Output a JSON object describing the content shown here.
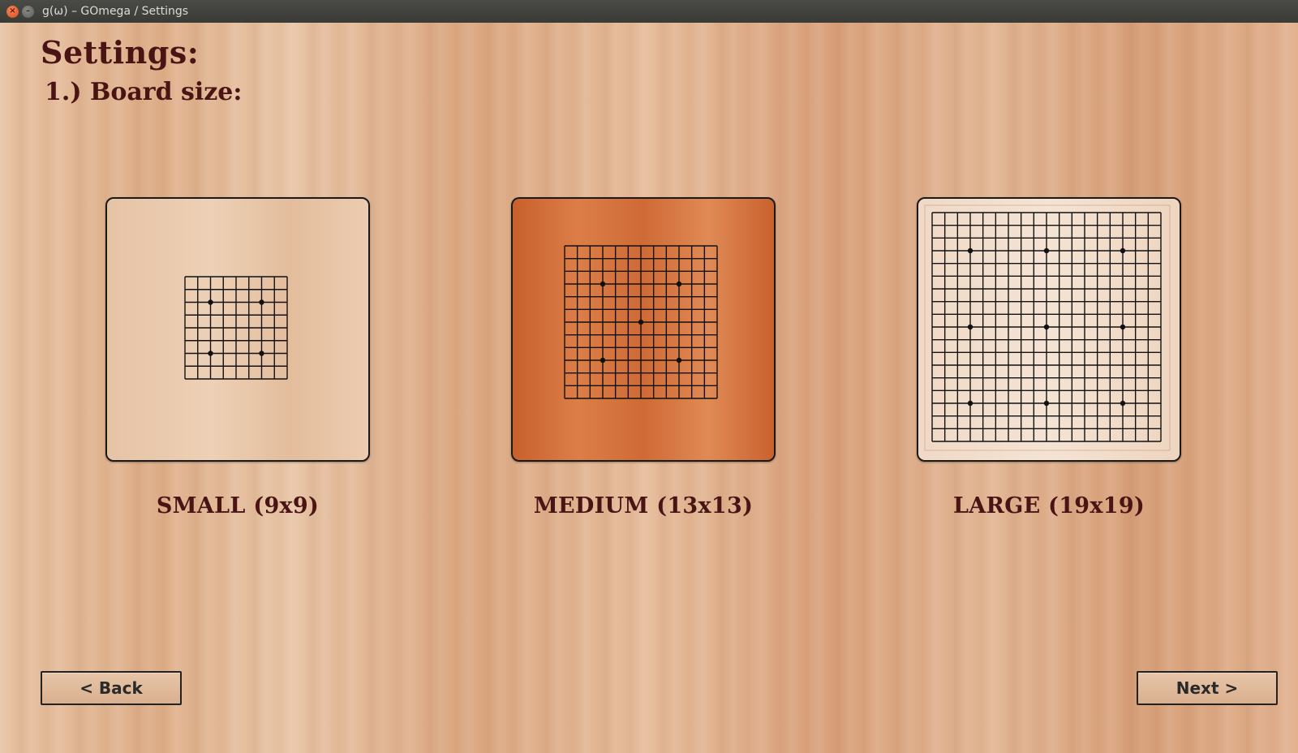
{
  "window": {
    "title": "g(ω) – GOmega / Settings",
    "close_icon": "close-icon",
    "minimize_icon": "minimize-icon"
  },
  "page": {
    "heading": "Settings:",
    "subheading": "1.) Board size:"
  },
  "options": [
    {
      "label": "SMALL (9x9)",
      "size": 9,
      "icon": "small-board-icon"
    },
    {
      "label": "MEDIUM (13x13)",
      "size": 13,
      "icon": "medium-board-icon"
    },
    {
      "label": "LARGE (19x19)",
      "size": 19,
      "icon": "large-board-icon"
    }
  ],
  "nav": {
    "back_label": "< Back",
    "next_label": "Next >"
  },
  "colors": {
    "heading": "#4a1414",
    "small_board": "#e8c7aa",
    "medium_board": "#d4703c",
    "large_board": "#f2dcc9"
  }
}
